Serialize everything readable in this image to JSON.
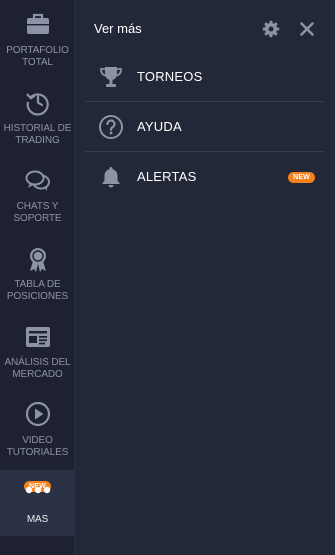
{
  "sidebar": {
    "items": [
      {
        "label": "PORTAFOLIO\nTOTAL",
        "icon": "briefcase-icon"
      },
      {
        "label": "HISTORIAL DE\nTRADING",
        "icon": "history-icon"
      },
      {
        "label": "CHATS Y\nSOPORTE",
        "icon": "chat-icon"
      },
      {
        "label": "TABLA DE\nPOSICIONES",
        "icon": "medal-icon"
      },
      {
        "label": "ANÁLISIS DEL\nMERCADO",
        "icon": "newspaper-icon"
      },
      {
        "label": "VIDEO\nTUTORIALES",
        "icon": "play-icon"
      },
      {
        "label": "MAS",
        "icon": "more-dots-icon",
        "badge": "NEW",
        "active": true
      }
    ]
  },
  "panel": {
    "title": "Ver más",
    "settings_icon": "gear-icon",
    "close_icon": "close-icon",
    "items": [
      {
        "label": "TORNEOS",
        "icon": "trophy-icon"
      },
      {
        "label": "AYUDA",
        "icon": "help-circle-icon"
      },
      {
        "label": "ALERTAS",
        "icon": "bell-icon",
        "badge": "NEW"
      }
    ]
  },
  "colors": {
    "sidebar_bg": "#1d2130",
    "panel_bg": "#232839",
    "active_bg": "#2c3245",
    "badge": "#f5821f",
    "icon": "#8d93a6",
    "text": "#ffffff"
  }
}
